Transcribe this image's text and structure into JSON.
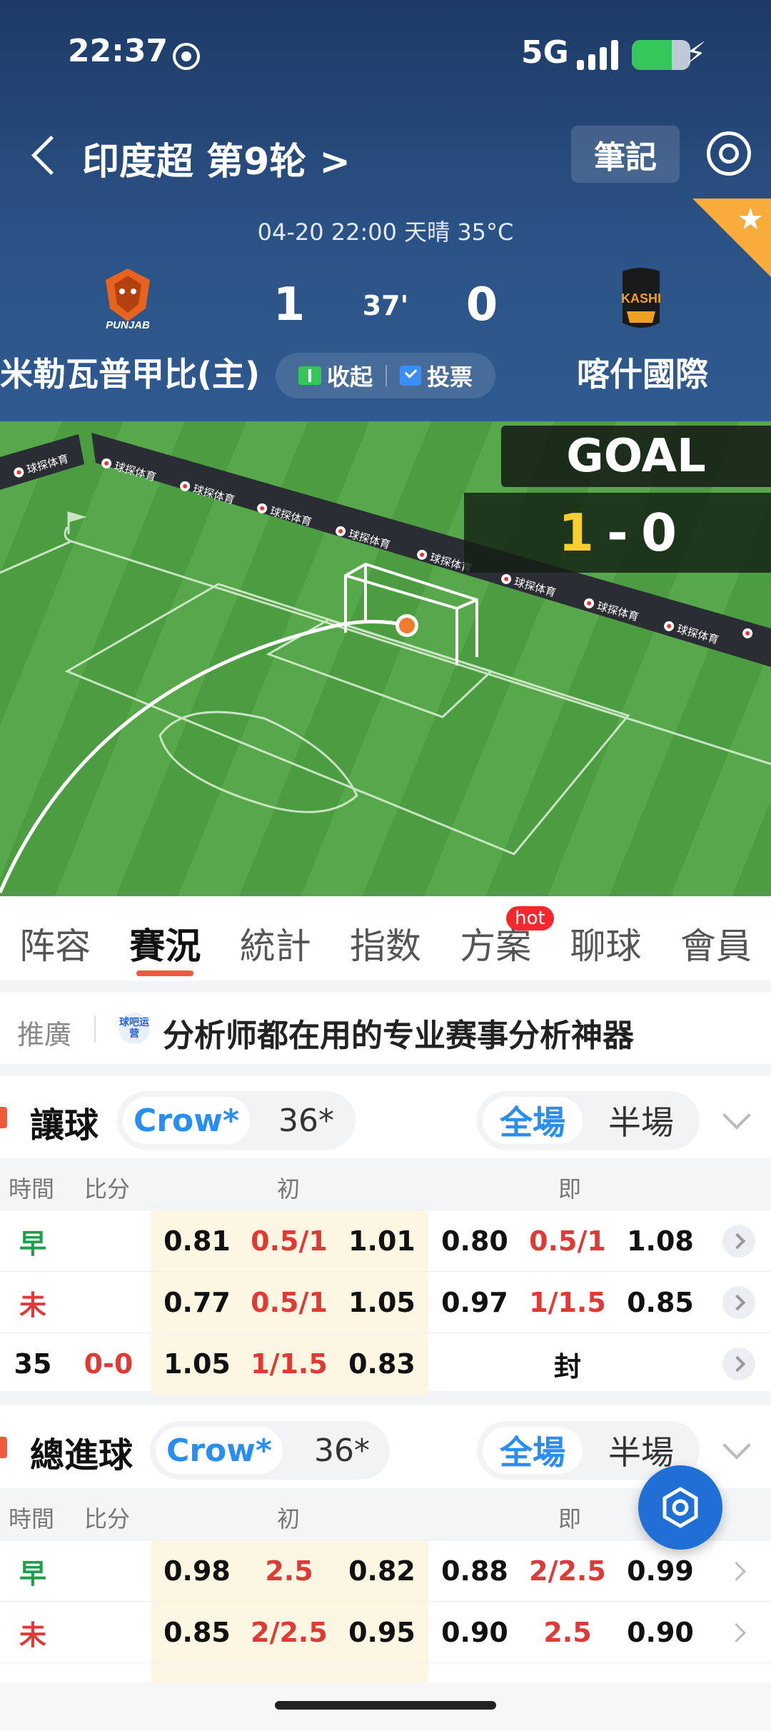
{
  "status_bar": {
    "time": "22:37",
    "network": "5G"
  },
  "header": {
    "league_title": "印度超 第9轮 >",
    "note_button": "筆記",
    "match_meta": "04-20 22:00    天晴 35°C",
    "home_team": "米勒瓦普甲比(主)",
    "away_team": "喀什國際",
    "home_logo_text": "PUNJAB",
    "away_logo_text": "KASHI",
    "home_score": "1",
    "away_score": "0",
    "minute": "37'",
    "collapse_label": "收起",
    "vote_label": "投票"
  },
  "field": {
    "goal_label": "GOAL",
    "score_home": "1",
    "score_sep": "-",
    "score_away": "0",
    "ad_text": "球探体育"
  },
  "tabs": [
    {
      "label": "阵容"
    },
    {
      "label": "賽況"
    },
    {
      "label": "統計"
    },
    {
      "label": "指数"
    },
    {
      "label": "方案",
      "badge": "hot"
    },
    {
      "label": "聊球"
    },
    {
      "label": "會員"
    }
  ],
  "promo": {
    "tag": "推廣",
    "icon_text": "球吧运营",
    "text": "分析师都在用的专业赛事分析神器"
  },
  "handicap": {
    "title": "讓球",
    "company": "Crow*",
    "other_company": "36*",
    "full_label": "全場",
    "half_label": "半場",
    "columns": {
      "time": "時間",
      "score": "比分",
      "initial": "初",
      "live": "即"
    },
    "rows": [
      {
        "time": "早",
        "score": "",
        "i1": "0.81",
        "i2": "0.5/1",
        "i3": "1.01",
        "l1": "0.80",
        "l2": "0.5/1",
        "l3": "1.08"
      },
      {
        "time": "未",
        "score": "",
        "i1": "0.77",
        "i2": "0.5/1",
        "i3": "1.05",
        "l1": "0.97",
        "l2": "1/1.5",
        "l3": "0.85"
      },
      {
        "time": "35",
        "score": "0-0",
        "i1": "1.05",
        "i2": "1/1.5",
        "i3": "0.83",
        "l1": "",
        "l2": "封",
        "l3": ""
      }
    ]
  },
  "total_goals": {
    "title": "總進球",
    "company": "Crow*",
    "other_company": "36*",
    "full_label": "全場",
    "half_label": "半場",
    "columns": {
      "time": "時間",
      "score": "比分",
      "initial": "初",
      "live": "即"
    },
    "rows": [
      {
        "time": "早",
        "score": "",
        "i1": "0.98",
        "i2": "2.5",
        "i3": "0.82",
        "l1": "0.88",
        "l2": "2/2.5",
        "l3": "0.99"
      },
      {
        "time": "未",
        "score": "",
        "i1": "0.85",
        "i2": "2/2.5",
        "i3": "0.95",
        "l1": "0.90",
        "l2": "2.5",
        "l3": "0.90"
      }
    ]
  },
  "colors": {
    "header_top": "#1d3a66",
    "accent_blue": "#2a8ef0",
    "accent_red": "#e03a36",
    "accent_orange": "#f05a3c",
    "pitch_green": "#4fa044"
  }
}
